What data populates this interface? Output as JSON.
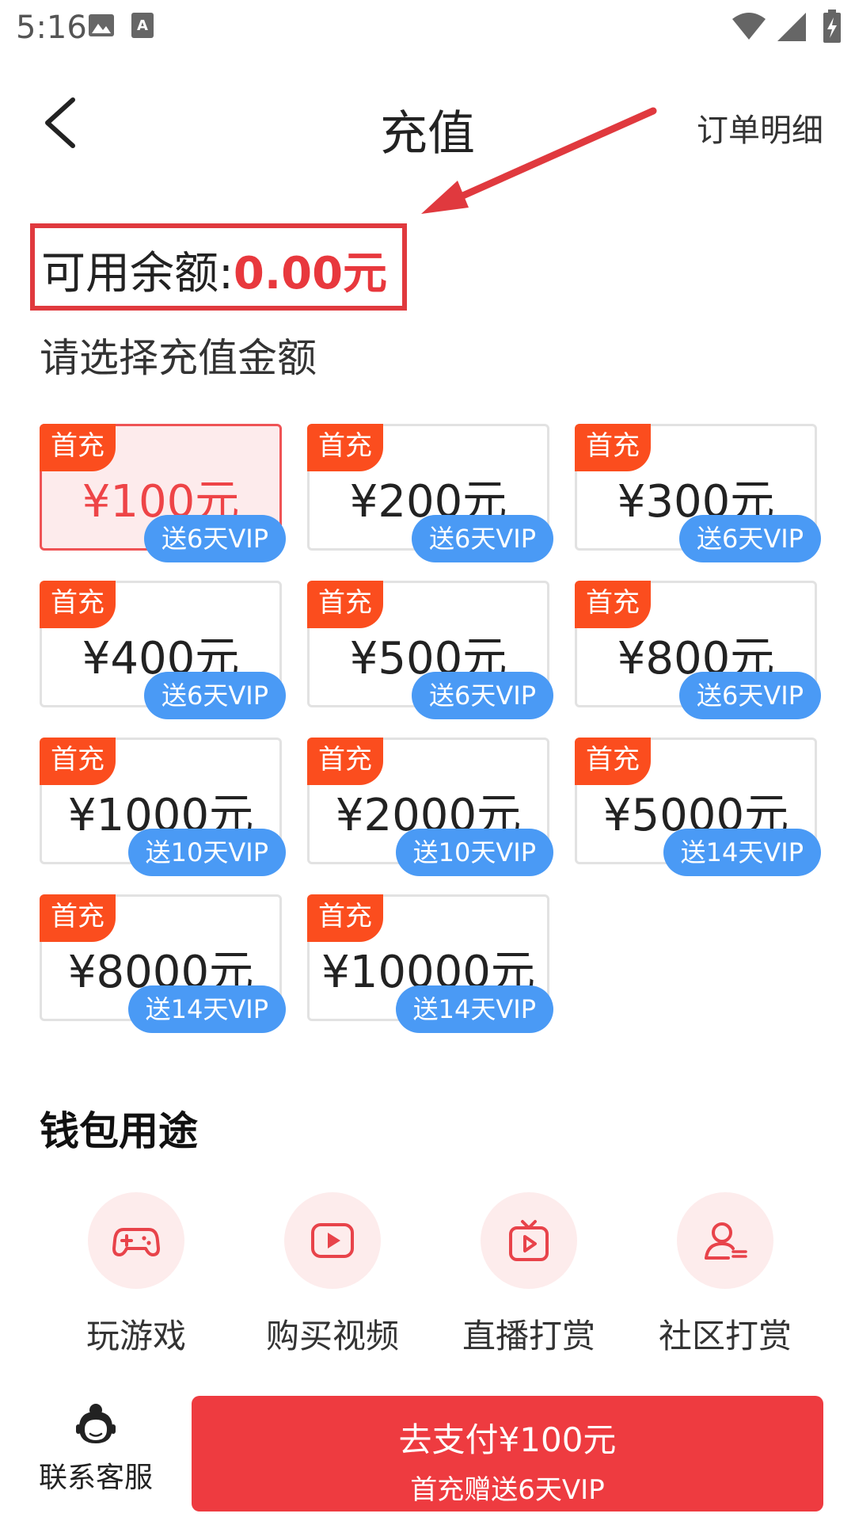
{
  "status_bar": {
    "time": "5:16"
  },
  "header": {
    "title": "充值",
    "orders_link": "订单明细"
  },
  "balance": {
    "label": "可用余额:",
    "value": "0.00元"
  },
  "select_label": "请选择充值金额",
  "options": [
    {
      "tag": "首充",
      "amount": "¥100元",
      "bonus": "送6天VIP",
      "selected": true
    },
    {
      "tag": "首充",
      "amount": "¥200元",
      "bonus": "送6天VIP"
    },
    {
      "tag": "首充",
      "amount": "¥300元",
      "bonus": "送6天VIP"
    },
    {
      "tag": "首充",
      "amount": "¥400元",
      "bonus": "送6天VIP"
    },
    {
      "tag": "首充",
      "amount": "¥500元",
      "bonus": "送6天VIP"
    },
    {
      "tag": "首充",
      "amount": "¥800元",
      "bonus": "送6天VIP"
    },
    {
      "tag": "首充",
      "amount": "¥1000元",
      "bonus": "送10天VIP"
    },
    {
      "tag": "首充",
      "amount": "¥2000元",
      "bonus": "送10天VIP"
    },
    {
      "tag": "首充",
      "amount": "¥5000元",
      "bonus": "送14天VIP"
    },
    {
      "tag": "首充",
      "amount": "¥8000元",
      "bonus": "送14天VIP"
    },
    {
      "tag": "首充",
      "amount": "¥10000元",
      "bonus": "送14天VIP"
    }
  ],
  "usage": {
    "title": "钱包用途",
    "items": [
      {
        "label": "玩游戏",
        "icon": "gamepad-icon"
      },
      {
        "label": "购买视频",
        "icon": "video-play-icon"
      },
      {
        "label": "直播打赏",
        "icon": "live-tv-icon"
      },
      {
        "label": "社区打赏",
        "icon": "community-user-icon"
      }
    ]
  },
  "bottom": {
    "service_label": "联系客服",
    "pay_label": "去支付¥100元",
    "pay_sub": "首充赠送6天VIP"
  },
  "colors": {
    "accent": "#ee3b40",
    "tag": "#fb4d1e",
    "bonus": "#4a9af5",
    "annotation": "#e0393e"
  }
}
